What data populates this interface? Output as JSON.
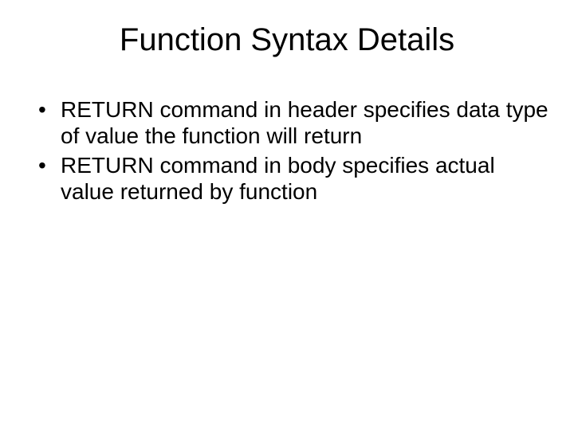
{
  "slide": {
    "title": "Function Syntax Details",
    "bullets": [
      "RETURN command in header specifies data type of value the function will return",
      "RETURN command in body specifies actual value returned by function"
    ]
  }
}
